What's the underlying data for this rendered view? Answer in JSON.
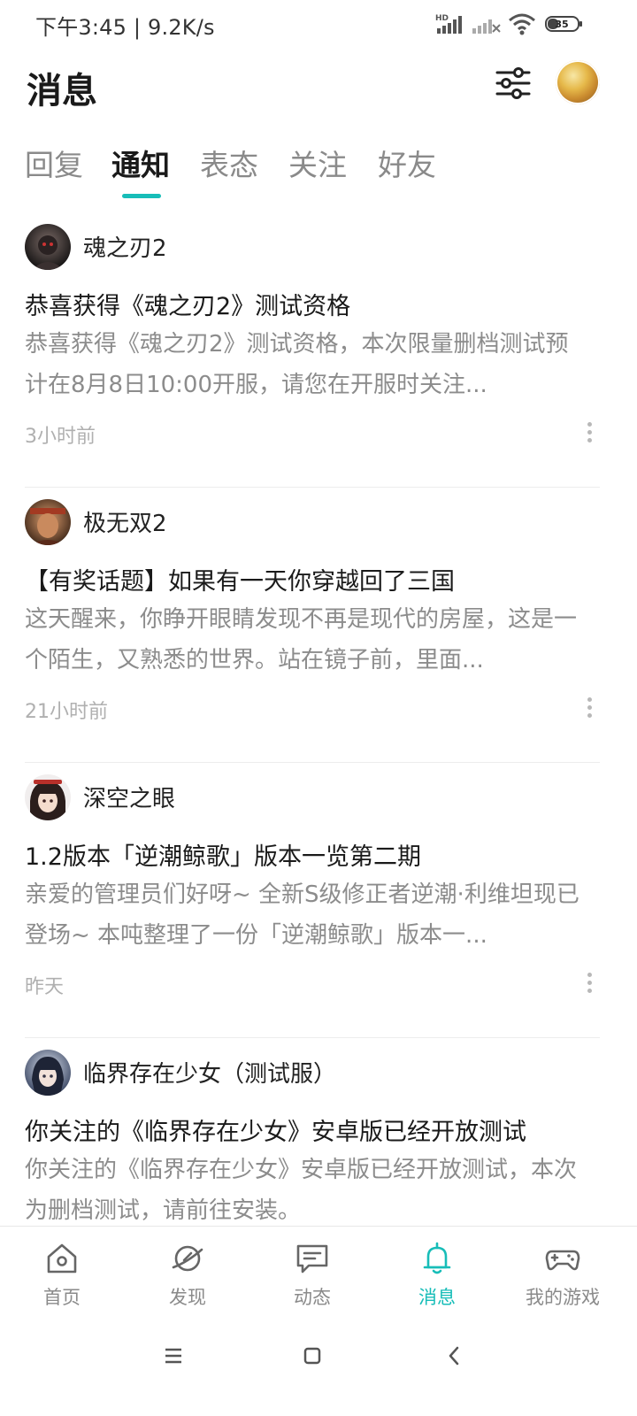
{
  "status_bar": {
    "time_speed": "下午3:45 | 9.2K/s",
    "network_label": "HD",
    "battery": "35"
  },
  "header": {
    "title": "消息"
  },
  "tabs": [
    {
      "label": "回复"
    },
    {
      "label": "通知"
    },
    {
      "label": "表态"
    },
    {
      "label": "关注"
    },
    {
      "label": "好友"
    }
  ],
  "active_tab": "通知",
  "notifications": [
    {
      "sender": "魂之刃2",
      "title": "恭喜获得《魂之刃2》测试资格",
      "body": "恭喜获得《魂之刃2》测试资格，本次限量删档测试预计在8月8日10:00开服，请您在开服时关注...",
      "time": "3小时前"
    },
    {
      "sender": "极无双2",
      "title": "【有奖话题】如果有一天你穿越回了三国",
      "body": "这天醒来，你睁开眼睛发现不再是现代的房屋，这是一个陌生，又熟悉的世界。站在镜子前，里面...",
      "time": "21小时前"
    },
    {
      "sender": "深空之眼",
      "title": "1.2版本「逆潮鲸歌」版本一览第二期",
      "body": "亲爱的管理员们好呀~ 全新S级修正者逆潮·利维坦现已登场~ 本吨整理了一份「逆潮鲸歌」版本一...",
      "time": "昨天"
    },
    {
      "sender": "临界存在少女（测试服）",
      "title": "你关注的《临界存在少女》安卓版已经开放测试",
      "body": "你关注的《临界存在少女》安卓版已经开放测试，本次为删档测试，请前往安装。",
      "time": ""
    }
  ],
  "bottom_nav": [
    {
      "label": "首页",
      "icon": "home-icon"
    },
    {
      "label": "发现",
      "icon": "discover-icon"
    },
    {
      "label": "动态",
      "icon": "feed-icon"
    },
    {
      "label": "消息",
      "icon": "bell-icon"
    },
    {
      "label": "我的游戏",
      "icon": "gamepad-icon"
    }
  ],
  "active_nav": "消息",
  "colors": {
    "accent": "#17bdb8",
    "text_primary": "#1a1a1a",
    "text_secondary": "#8c8c8c",
    "text_muted": "#b0b0b0"
  }
}
